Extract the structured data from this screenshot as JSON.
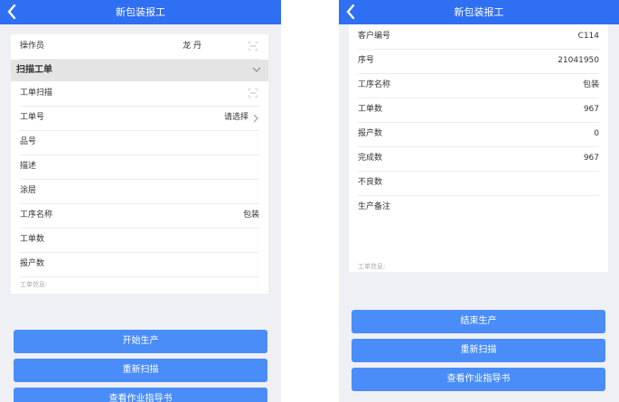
{
  "left": {
    "title": "新包装报工",
    "operator": {
      "label": "操作员",
      "value": "龙 丹"
    },
    "section_title": "扫描工单",
    "rows": [
      {
        "label": "工单扫描",
        "value": ""
      },
      {
        "label": "工单号",
        "value": "请选择"
      },
      {
        "label": "品号",
        "value": ""
      },
      {
        "label": "描述",
        "value": ""
      },
      {
        "label": "涂层",
        "value": ""
      },
      {
        "label": "工序名称",
        "value": "包装"
      },
      {
        "label": "工单数",
        "value": ""
      },
      {
        "label": "报产数",
        "value": ""
      }
    ],
    "info_label": "工单信息:",
    "buttons": [
      "开始生产",
      "重新扫描",
      "查看作业指导书"
    ]
  },
  "right": {
    "title": "新包装报工",
    "rows": [
      {
        "label": "客户编号",
        "value": "C114"
      },
      {
        "label": "序号",
        "value": "21041950"
      },
      {
        "label": "工序名称",
        "value": "包装"
      },
      {
        "label": "工单数",
        "value": "967"
      },
      {
        "label": "报产数",
        "value": "0"
      },
      {
        "label": "完成数",
        "value": "967"
      },
      {
        "label": "不良数",
        "value": ""
      },
      {
        "label": "生产备注",
        "value": ""
      }
    ],
    "info_label": "工单信息:",
    "buttons": [
      "结束生产",
      "重新扫描",
      "查看作业指导书"
    ]
  },
  "colors": {
    "header": "#2f6ff2",
    "button": "#4a8df8",
    "background": "#eef0f3"
  },
  "icons": {
    "back": "chevron-left-icon",
    "scan": "scan-icon",
    "expand": "chevron-down-icon",
    "select": "chevron-right-icon"
  }
}
